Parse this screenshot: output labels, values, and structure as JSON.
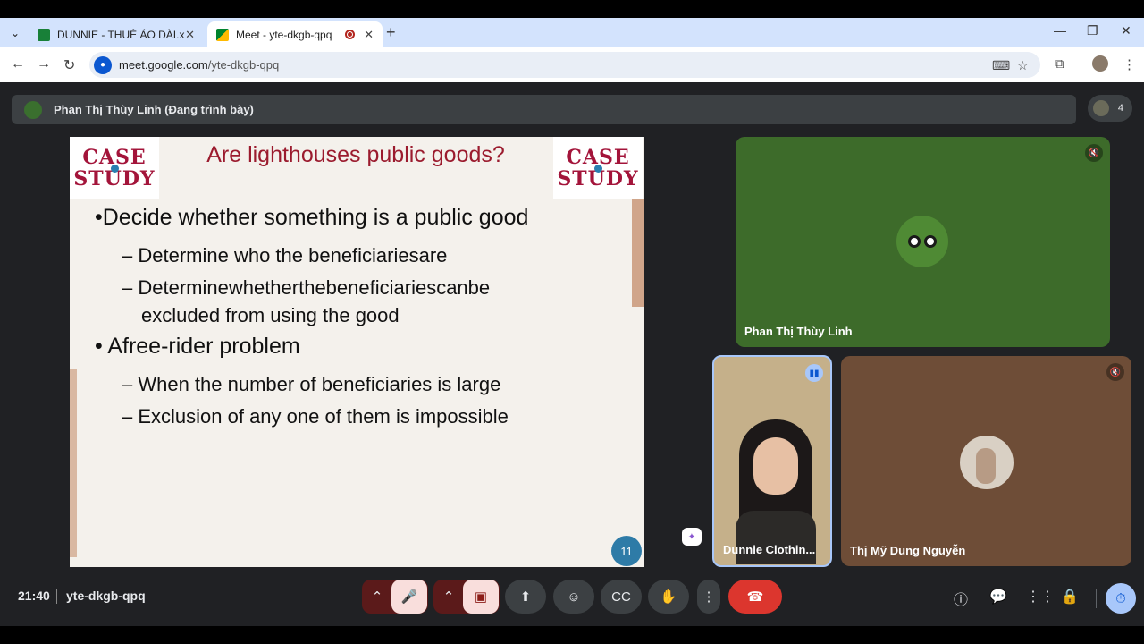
{
  "browser": {
    "tabs": [
      {
        "title": "DUNNIE - THUÊ ÁO DÀI.xlsx",
        "favicon_color": "#188038"
      },
      {
        "title": "Meet - yte-dkgb-qpq",
        "favicon_color": "#00ac47"
      }
    ],
    "url_host": "meet.google.com",
    "url_path": "/yte-dkgb-qpq"
  },
  "meet": {
    "presenter_banner": "Phan Thị Thùy Linh (Đang trình bày)",
    "participant_count": "4",
    "meeting_code": "yte-dkgb-qpq",
    "time": "21:40",
    "tiles": [
      {
        "name": "Phan Thị Thùy Linh",
        "muted": true
      },
      {
        "name": "Dunnie Clothin...",
        "speaking": true
      },
      {
        "name": "Thị Mỹ Dung Nguyễn",
        "muted": true
      }
    ]
  },
  "slide": {
    "logo_line1": "CASE",
    "logo_line2": "STUDY",
    "title": "Are lighthouses public goods?",
    "bullets": [
      "•Decide whether something is a public good",
      "– Determine who the beneficiariesare",
      "– Determinewhetherthebeneficiariescanbe",
      "excluded from using the good",
      "• Afree-rider problem",
      "– When the number of beneficiaries is large",
      "– Exclusion of any one of them is impossible"
    ],
    "page_number": "11"
  },
  "colors": {
    "accent": "#0b57d0",
    "end_call": "#dc362e",
    "slide_title": "#9b1b2e"
  }
}
